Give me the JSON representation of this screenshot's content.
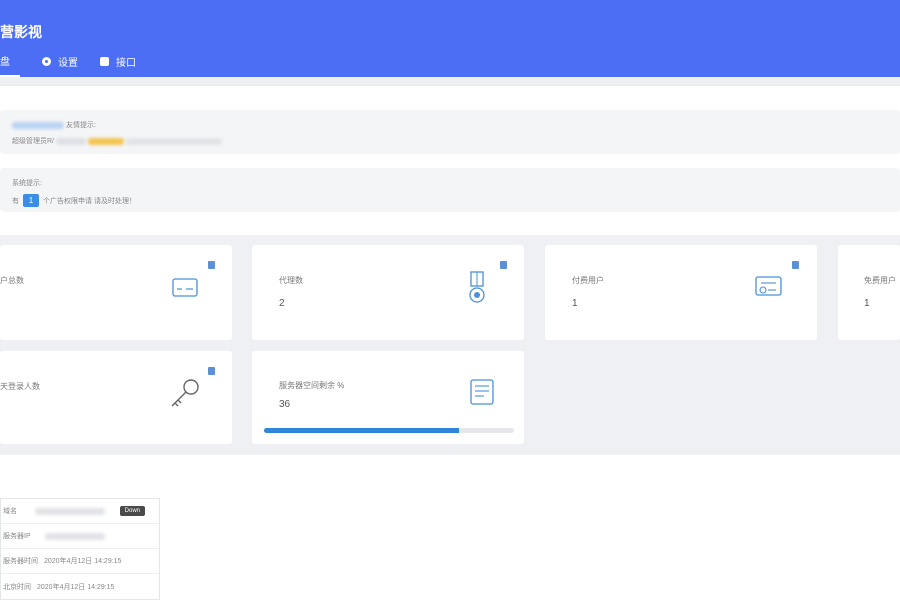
{
  "header": {
    "app_title": "营影视",
    "nav": [
      {
        "label": "盘",
        "icon": "dashboard-icon",
        "active": true
      },
      {
        "label": "设置",
        "icon": "settings-icon",
        "active": false
      },
      {
        "label": "接口",
        "icon": "api-icon",
        "active": false
      }
    ]
  },
  "notices": {
    "first": {
      "title": "友情提示:",
      "text": "超级管理员R/"
    },
    "second": {
      "title": "系统提示:",
      "prefix": "有",
      "count": "1",
      "suffix": "个广告权限申请 请及时处理！"
    }
  },
  "stats": [
    {
      "label": "户总数",
      "value": "",
      "icon": "card-icon"
    },
    {
      "label": "代理数",
      "value": "2",
      "icon": "medal-icon"
    },
    {
      "label": "付费用户",
      "value": "1",
      "icon": "certificate-icon"
    },
    {
      "label": "免费用户",
      "value": "1",
      "icon": "user-icon"
    },
    {
      "label": "天登录人数",
      "value": "",
      "icon": "key-icon"
    },
    {
      "label": "服务器空间剩余 %",
      "value": "36",
      "icon": "document-icon",
      "progress_percent": 78
    }
  ],
  "info_table": {
    "rows": [
      {
        "label": "域名",
        "value": "",
        "button": "Down"
      },
      {
        "label": "服务器IP",
        "value": ""
      },
      {
        "label": "服务器时间",
        "value": "2020年4月12日 14:29:15"
      },
      {
        "label": "北京时间",
        "value": "2020年4月12日 14:29:15"
      }
    ]
  },
  "colors": {
    "primary": "#4b6ef5",
    "progress": "#2f86d9",
    "badge": "#3a8ee6"
  }
}
